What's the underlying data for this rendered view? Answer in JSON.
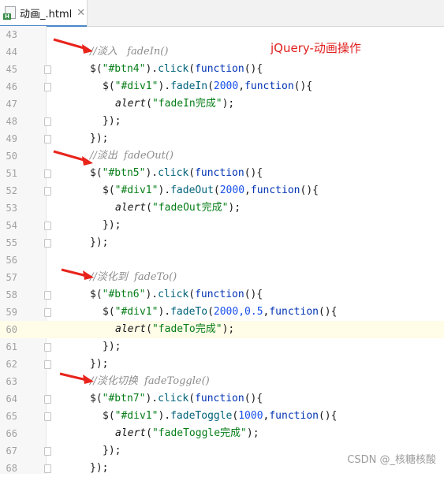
{
  "tab": {
    "file_name": "动画_.html",
    "icon_badge": "H",
    "close": "✕"
  },
  "overlay_title": "jQuery-动画操作",
  "watermark": "CSDN @_核糖核酸",
  "lines": [
    {
      "n": "43",
      "kind": "blank"
    },
    {
      "n": "44",
      "kind": "comment",
      "text": "//淡入   fadeIn()"
    },
    {
      "n": "45",
      "kind": "click",
      "sel": "\"#btn4\""
    },
    {
      "n": "46",
      "kind": "anim",
      "method": "fadeIn",
      "args": "2000"
    },
    {
      "n": "47",
      "kind": "alert",
      "msg": "\"fadeIn完成\""
    },
    {
      "n": "48",
      "kind": "close2"
    },
    {
      "n": "49",
      "kind": "close1"
    },
    {
      "n": "50",
      "kind": "comment",
      "text": "//淡出  fadeOut()"
    },
    {
      "n": "51",
      "kind": "click",
      "sel": "\"#btn5\""
    },
    {
      "n": "52",
      "kind": "anim",
      "method": "fadeOut",
      "args": "2000"
    },
    {
      "n": "53",
      "kind": "alert",
      "msg": "\"fadeOut完成\""
    },
    {
      "n": "54",
      "kind": "close2"
    },
    {
      "n": "55",
      "kind": "close1"
    },
    {
      "n": "56",
      "kind": "blank"
    },
    {
      "n": "57",
      "kind": "comment",
      "text": "//淡化到  fadeTo()"
    },
    {
      "n": "58",
      "kind": "click",
      "sel": "\"#btn6\""
    },
    {
      "n": "59",
      "kind": "anim",
      "method": "fadeTo",
      "args": "2000,0.5"
    },
    {
      "n": "60",
      "kind": "alert",
      "msg": "\"fadeTo完成\"",
      "current": true
    },
    {
      "n": "61",
      "kind": "close2"
    },
    {
      "n": "62",
      "kind": "close1"
    },
    {
      "n": "63",
      "kind": "comment",
      "text": "//淡化切换  fadeToggle()"
    },
    {
      "n": "64",
      "kind": "click",
      "sel": "\"#btn7\""
    },
    {
      "n": "65",
      "kind": "anim",
      "method": "fadeToggle",
      "args": "1000"
    },
    {
      "n": "66",
      "kind": "alert",
      "msg": "\"fadeToggle完成\""
    },
    {
      "n": "67",
      "kind": "close2"
    },
    {
      "n": "68",
      "kind": "close1"
    }
  ],
  "tokens": {
    "dollar": "$(",
    "click": ".click(",
    "function": "function",
    "open_fn": "(){",
    "div_sel": "\"#div1\"",
    "alert": "alert",
    "close_call": ");",
    "close_block": "});"
  },
  "colors": {
    "comment": "#8c8c8c",
    "string": "#067d17",
    "keyword": "#0033b3",
    "number": "#1750eb",
    "method": "#00627a",
    "annotation": "#e02020",
    "current_line": "#fffce8",
    "arrow": "#e8241c"
  }
}
